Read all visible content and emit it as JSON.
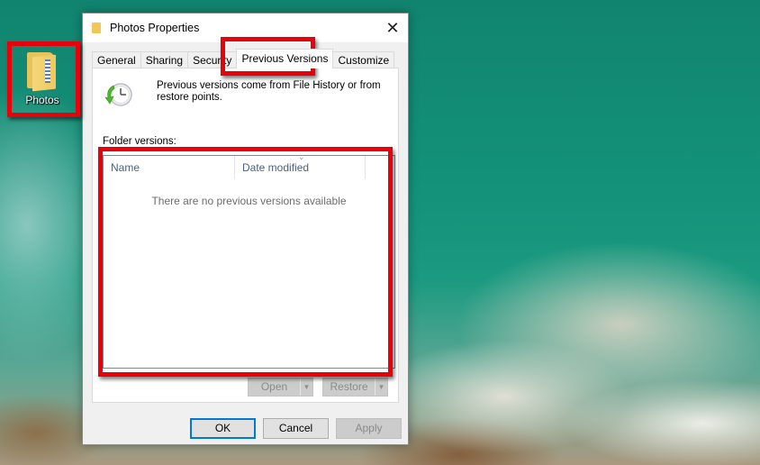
{
  "desktop": {
    "icons": [
      {
        "label": "Photos",
        "icon": "folder-icon"
      }
    ]
  },
  "dialog": {
    "title": "Photos Properties",
    "title_icon": "folder-icon",
    "close_icon": "close-icon",
    "close_glyph": "✕",
    "tabs": [
      {
        "label": "General",
        "active": false
      },
      {
        "label": "Sharing",
        "active": false
      },
      {
        "label": "Security",
        "active": false
      },
      {
        "label": "Previous Versions",
        "active": true
      },
      {
        "label": "Customize",
        "active": false
      }
    ],
    "previous_versions": {
      "icon": "restore-clock-icon",
      "info_text": "Previous versions come from File History or from restore points.",
      "folder_versions_label": "Folder versions:",
      "columns": [
        {
          "label": "Name"
        },
        {
          "label": "Date modified",
          "sorted": true
        }
      ],
      "sort_glyph": "⌄",
      "rows": [],
      "empty_message": "There are no previous versions available",
      "open_button": {
        "label": "Open",
        "enabled": false,
        "dropdown_glyph": "▼"
      },
      "restore_button": {
        "label": "Restore",
        "enabled": false,
        "dropdown_glyph": "▼"
      }
    },
    "buttons": {
      "ok": "OK",
      "cancel": "Cancel",
      "apply": "Apply",
      "apply_enabled": false
    }
  },
  "annotations": {
    "highlight_color": "#e8000b",
    "highlighted": [
      "desktop-icon-photos",
      "tab-previous-versions",
      "folder-versions-list"
    ]
  }
}
